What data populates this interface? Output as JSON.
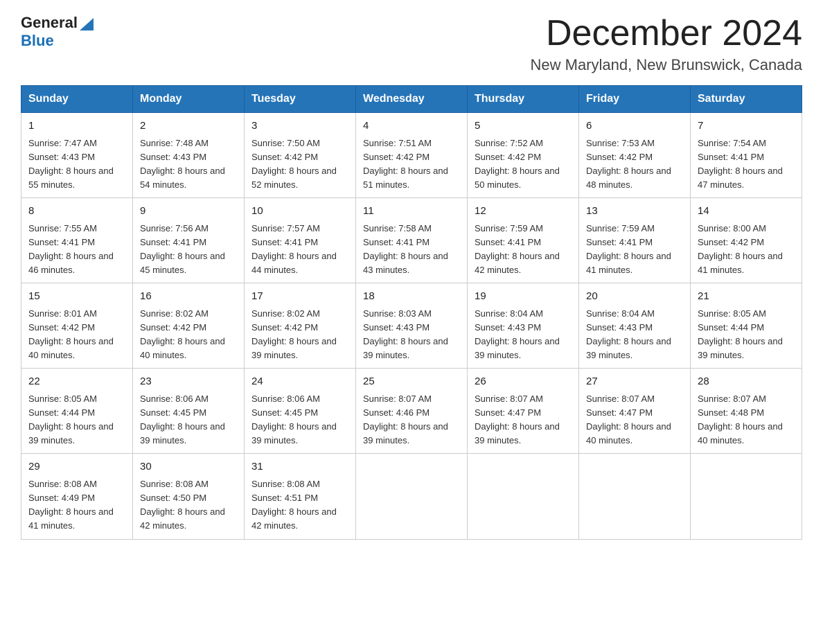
{
  "header": {
    "logo_general": "General",
    "logo_blue": "Blue",
    "month": "December 2024",
    "location": "New Maryland, New Brunswick, Canada"
  },
  "weekdays": [
    "Sunday",
    "Monday",
    "Tuesday",
    "Wednesday",
    "Thursday",
    "Friday",
    "Saturday"
  ],
  "weeks": [
    [
      {
        "day": "1",
        "sunrise": "7:47 AM",
        "sunset": "4:43 PM",
        "daylight": "8 hours and 55 minutes."
      },
      {
        "day": "2",
        "sunrise": "7:48 AM",
        "sunset": "4:43 PM",
        "daylight": "8 hours and 54 minutes."
      },
      {
        "day": "3",
        "sunrise": "7:50 AM",
        "sunset": "4:42 PM",
        "daylight": "8 hours and 52 minutes."
      },
      {
        "day": "4",
        "sunrise": "7:51 AM",
        "sunset": "4:42 PM",
        "daylight": "8 hours and 51 minutes."
      },
      {
        "day": "5",
        "sunrise": "7:52 AM",
        "sunset": "4:42 PM",
        "daylight": "8 hours and 50 minutes."
      },
      {
        "day": "6",
        "sunrise": "7:53 AM",
        "sunset": "4:42 PM",
        "daylight": "8 hours and 48 minutes."
      },
      {
        "day": "7",
        "sunrise": "7:54 AM",
        "sunset": "4:41 PM",
        "daylight": "8 hours and 47 minutes."
      }
    ],
    [
      {
        "day": "8",
        "sunrise": "7:55 AM",
        "sunset": "4:41 PM",
        "daylight": "8 hours and 46 minutes."
      },
      {
        "day": "9",
        "sunrise": "7:56 AM",
        "sunset": "4:41 PM",
        "daylight": "8 hours and 45 minutes."
      },
      {
        "day": "10",
        "sunrise": "7:57 AM",
        "sunset": "4:41 PM",
        "daylight": "8 hours and 44 minutes."
      },
      {
        "day": "11",
        "sunrise": "7:58 AM",
        "sunset": "4:41 PM",
        "daylight": "8 hours and 43 minutes."
      },
      {
        "day": "12",
        "sunrise": "7:59 AM",
        "sunset": "4:41 PM",
        "daylight": "8 hours and 42 minutes."
      },
      {
        "day": "13",
        "sunrise": "7:59 AM",
        "sunset": "4:41 PM",
        "daylight": "8 hours and 41 minutes."
      },
      {
        "day": "14",
        "sunrise": "8:00 AM",
        "sunset": "4:42 PM",
        "daylight": "8 hours and 41 minutes."
      }
    ],
    [
      {
        "day": "15",
        "sunrise": "8:01 AM",
        "sunset": "4:42 PM",
        "daylight": "8 hours and 40 minutes."
      },
      {
        "day": "16",
        "sunrise": "8:02 AM",
        "sunset": "4:42 PM",
        "daylight": "8 hours and 40 minutes."
      },
      {
        "day": "17",
        "sunrise": "8:02 AM",
        "sunset": "4:42 PM",
        "daylight": "8 hours and 39 minutes."
      },
      {
        "day": "18",
        "sunrise": "8:03 AM",
        "sunset": "4:43 PM",
        "daylight": "8 hours and 39 minutes."
      },
      {
        "day": "19",
        "sunrise": "8:04 AM",
        "sunset": "4:43 PM",
        "daylight": "8 hours and 39 minutes."
      },
      {
        "day": "20",
        "sunrise": "8:04 AM",
        "sunset": "4:43 PM",
        "daylight": "8 hours and 39 minutes."
      },
      {
        "day": "21",
        "sunrise": "8:05 AM",
        "sunset": "4:44 PM",
        "daylight": "8 hours and 39 minutes."
      }
    ],
    [
      {
        "day": "22",
        "sunrise": "8:05 AM",
        "sunset": "4:44 PM",
        "daylight": "8 hours and 39 minutes."
      },
      {
        "day": "23",
        "sunrise": "8:06 AM",
        "sunset": "4:45 PM",
        "daylight": "8 hours and 39 minutes."
      },
      {
        "day": "24",
        "sunrise": "8:06 AM",
        "sunset": "4:45 PM",
        "daylight": "8 hours and 39 minutes."
      },
      {
        "day": "25",
        "sunrise": "8:07 AM",
        "sunset": "4:46 PM",
        "daylight": "8 hours and 39 minutes."
      },
      {
        "day": "26",
        "sunrise": "8:07 AM",
        "sunset": "4:47 PM",
        "daylight": "8 hours and 39 minutes."
      },
      {
        "day": "27",
        "sunrise": "8:07 AM",
        "sunset": "4:47 PM",
        "daylight": "8 hours and 40 minutes."
      },
      {
        "day": "28",
        "sunrise": "8:07 AM",
        "sunset": "4:48 PM",
        "daylight": "8 hours and 40 minutes."
      }
    ],
    [
      {
        "day": "29",
        "sunrise": "8:08 AM",
        "sunset": "4:49 PM",
        "daylight": "8 hours and 41 minutes."
      },
      {
        "day": "30",
        "sunrise": "8:08 AM",
        "sunset": "4:50 PM",
        "daylight": "8 hours and 42 minutes."
      },
      {
        "day": "31",
        "sunrise": "8:08 AM",
        "sunset": "4:51 PM",
        "daylight": "8 hours and 42 minutes."
      },
      null,
      null,
      null,
      null
    ]
  ]
}
